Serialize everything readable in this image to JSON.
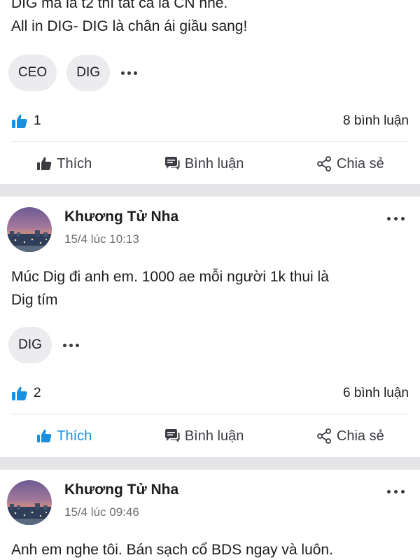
{
  "post1": {
    "text_line1": "DIG mà là t2 thì tất cả là CN nhé.",
    "text_line2": "All in DIG- DIG là chân ái giầu sang!",
    "tags": [
      "CEO",
      "DIG"
    ],
    "like_count": "1",
    "comment_count": "8 bình luận",
    "liked": false
  },
  "post2": {
    "author": "Khương Tử Nha",
    "time": "15/4 lúc 10:13",
    "text_line1": "Múc Dig đi anh em. 1000 ae mỗi người 1k thui là",
    "text_line2": "Dig tím",
    "tags": [
      "DIG"
    ],
    "like_count": "2",
    "comment_count": "6 bình luận",
    "liked": true
  },
  "post3": {
    "author": "Khương Tử Nha",
    "time": "15/4 lúc 09:46",
    "text_line1": "Anh em nghe tôi. Bán sạch cổ BDS ngay và luôn."
  },
  "actions": {
    "like": "Thích",
    "comment": "Bình luận",
    "share": "Chia sẻ"
  },
  "colors": {
    "accent": "#1a8fe0",
    "separator": "#e5e5e8",
    "tag_bg": "#ececef"
  },
  "icons": {
    "like": "thumbs-up-icon",
    "comment": "comment-bubble-icon",
    "share": "share-icon",
    "more": "more-dots-icon"
  }
}
